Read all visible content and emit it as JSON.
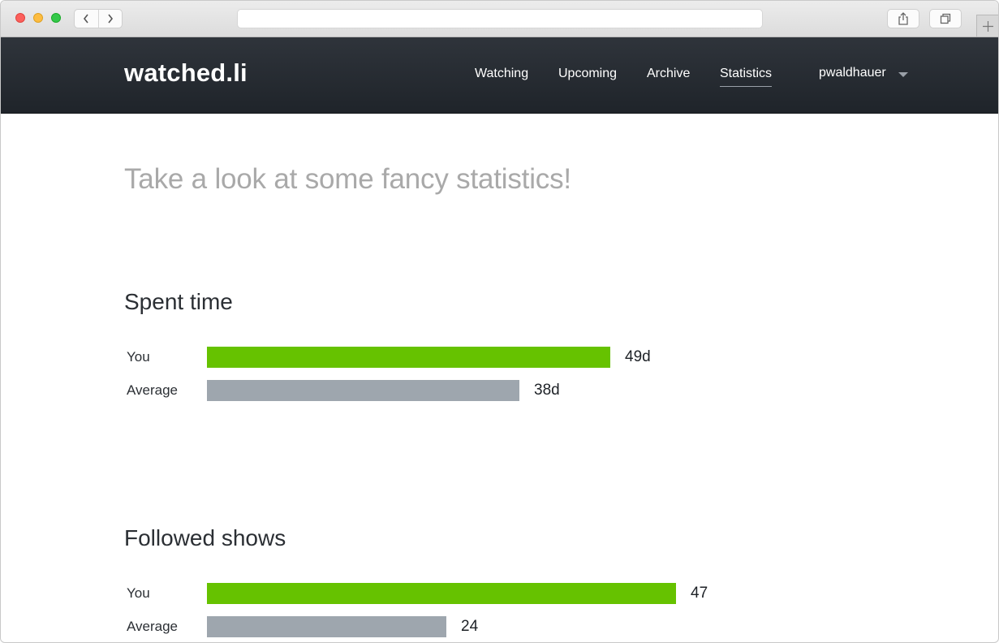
{
  "site": {
    "logo": "watched.li",
    "nav": [
      "Watching",
      "Upcoming",
      "Archive",
      "Statistics"
    ],
    "active_nav": "Statistics",
    "user": "pwaldhauer"
  },
  "page": {
    "tagline": "Take a look at some fancy statistics!"
  },
  "colors": {
    "you": "#66c200",
    "average": "#9ea6ae",
    "header": "#2a2f35"
  },
  "stats": [
    {
      "title": "Spent time",
      "rows": [
        {
          "label": "You",
          "value": 49,
          "display": "49d"
        },
        {
          "label": "Average",
          "value": 38,
          "display": "38d"
        }
      ]
    },
    {
      "title": "Followed shows",
      "rows": [
        {
          "label": "You",
          "value": 47,
          "display": "47"
        },
        {
          "label": "Average",
          "value": 24,
          "display": "24"
        }
      ]
    }
  ]
}
